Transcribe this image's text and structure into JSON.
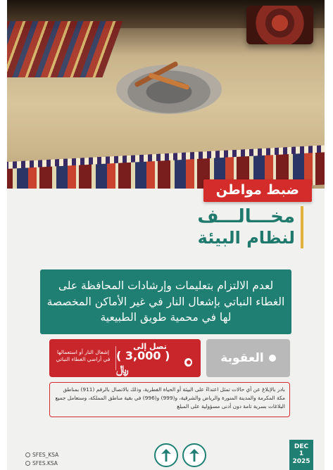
{
  "badge": {
    "text": "ضبط مواطن"
  },
  "title": {
    "line1": "مخـــالـــف",
    "line2": "لنظام البيئة"
  },
  "statement": {
    "text": "لعدم الالتزام بتعليمات وإرشادات المحافظة على الغطاء النباتي بإشعال النار في غير الأماكن المخصصة لها في محمية طويق الطبيعية"
  },
  "penalty": {
    "label": "العقوبة",
    "up_to": "تصل إلى",
    "amount": "( 3,000 ) ﷼",
    "note": "إشعال النار أو استعمالها في أراضي الغطاء النباتي"
  },
  "disclaimer": {
    "text": "بادر بالإبلاغ عن أي حالات تمثل اعتداءً على البيئة أو الحياة الفطرية، وذلك بالاتصال بالرقم (911) بمناطق مكة المكرمة والمدينة المنورة والرياض والشرقية، و(999) و(996) في بقية مناطق المملكة، وستعامل جميع البلاغات بسرية تامة دون أدنى مسؤولية على المبلغ"
  },
  "footer": {
    "handles": [
      "SFES_KSA",
      "SFES.KSA"
    ],
    "date": {
      "month": "DEC",
      "day": "1",
      "year": "2025"
    }
  },
  "colors": {
    "primary_green": "#1f7f73",
    "accent_red": "#d42b2b",
    "accent_gold": "#e3b23c"
  }
}
